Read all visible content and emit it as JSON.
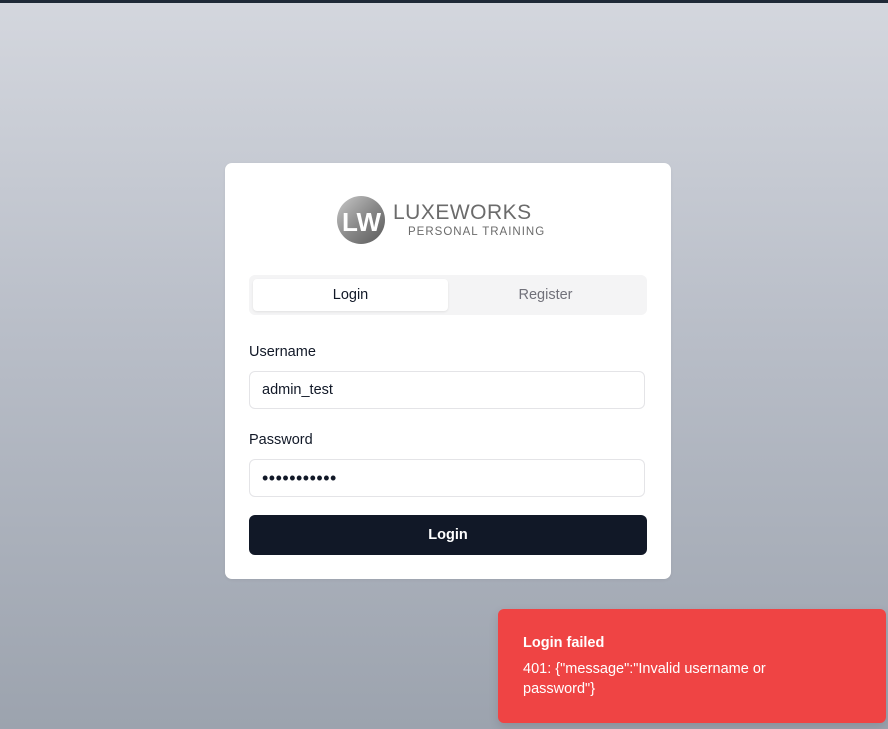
{
  "brand": {
    "logo_monogram": "LW",
    "logo_name": "LUXEWORKS",
    "logo_tagline": "PERSONAL TRAINING"
  },
  "tabs": [
    {
      "label": "Login",
      "active": true
    },
    {
      "label": "Register",
      "active": false
    }
  ],
  "form": {
    "username_label": "Username",
    "username_value": "admin_test",
    "password_label": "Password",
    "password_masked": "•••••••••••",
    "submit_label": "Login"
  },
  "toast": {
    "title": "Login failed",
    "message": "401: {\"message\":\"Invalid username or password\"}",
    "color": "#ef4444"
  },
  "colors": {
    "primary_button": "#111827",
    "inactive_tab_text": "#71717a"
  }
}
